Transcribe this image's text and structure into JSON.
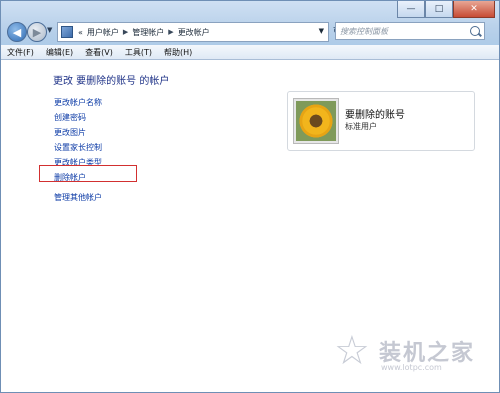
{
  "window": {
    "controls": {
      "minimize": "—",
      "maximize": "□",
      "close": "✕"
    }
  },
  "nav": {
    "back_icon": "arrow-left",
    "forward_icon": "arrow-right"
  },
  "address": {
    "icon": "control-panel-icon",
    "prefix": "«",
    "crumbs": [
      "用户帐户",
      "管理帐户",
      "更改帐户"
    ],
    "search_placeholder": "搜索控制面板"
  },
  "menu": [
    "文件(F)",
    "编辑(E)",
    "查看(V)",
    "工具(T)",
    "帮助(H)"
  ],
  "content": {
    "heading": "更改 要删除的账号 的帐户",
    "links": [
      "更改帐户名称",
      "创建密码",
      "更改图片",
      "设置家长控制",
      "更改帐户类型",
      "删除帐户"
    ],
    "extra_link": "管理其他帐户",
    "highlighted_link": "删除帐户"
  },
  "account": {
    "name": "要删除的账号",
    "type": "标准用户",
    "avatar": "sunflower-picture"
  },
  "watermark": {
    "text": "装机之家",
    "url": "www.lotpc.com"
  }
}
